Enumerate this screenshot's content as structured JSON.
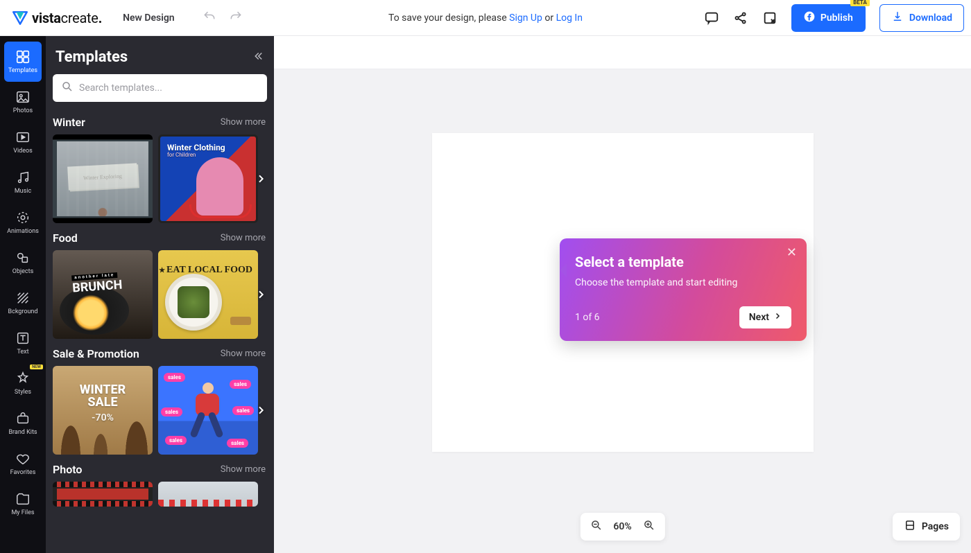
{
  "header": {
    "brand_a": "vista",
    "brand_b": "create",
    "new_design": "New Design",
    "save_msg_prefix": "To save your design, please ",
    "signup": "Sign Up",
    "or": " or ",
    "login": "Log In",
    "publish": "Publish",
    "beta": "BETA",
    "download": "Download"
  },
  "rail": {
    "templates": "Templates",
    "photos": "Photos",
    "videos": "Videos",
    "music": "Music",
    "animations": "Animations",
    "objects": "Objects",
    "background": "Bckground",
    "text": "Text",
    "styles": "Styles",
    "styles_badge": "NEW",
    "brandkits": "Brand Kits",
    "favorites": "Favorites",
    "myfiles": "My Files"
  },
  "panel": {
    "title": "Templates",
    "search_placeholder": "Search templates...",
    "show_more": "Show more",
    "categories": {
      "winter": "Winter",
      "food": "Food",
      "sale": "Sale & Promotion",
      "photo": "Photo"
    },
    "thumbs": {
      "winter1_note": "Winter Exploring",
      "winter2_title": "Winter Clothing",
      "winter2_sub": "for Children",
      "food1_small": "another late",
      "food1_big": "BRUNCH",
      "food2_line": "EAT LOCAL FOOD",
      "sale1_line1": "WINTER",
      "sale1_line2": "SALE",
      "sale1_pct": "-70%",
      "sale2_bubble": "sales"
    }
  },
  "popover": {
    "title": "Select a template",
    "body": "Choose the template and start editing",
    "step": "1 of 6",
    "next": "Next"
  },
  "canvas": {
    "zoom": "60%",
    "pages": "Pages"
  }
}
